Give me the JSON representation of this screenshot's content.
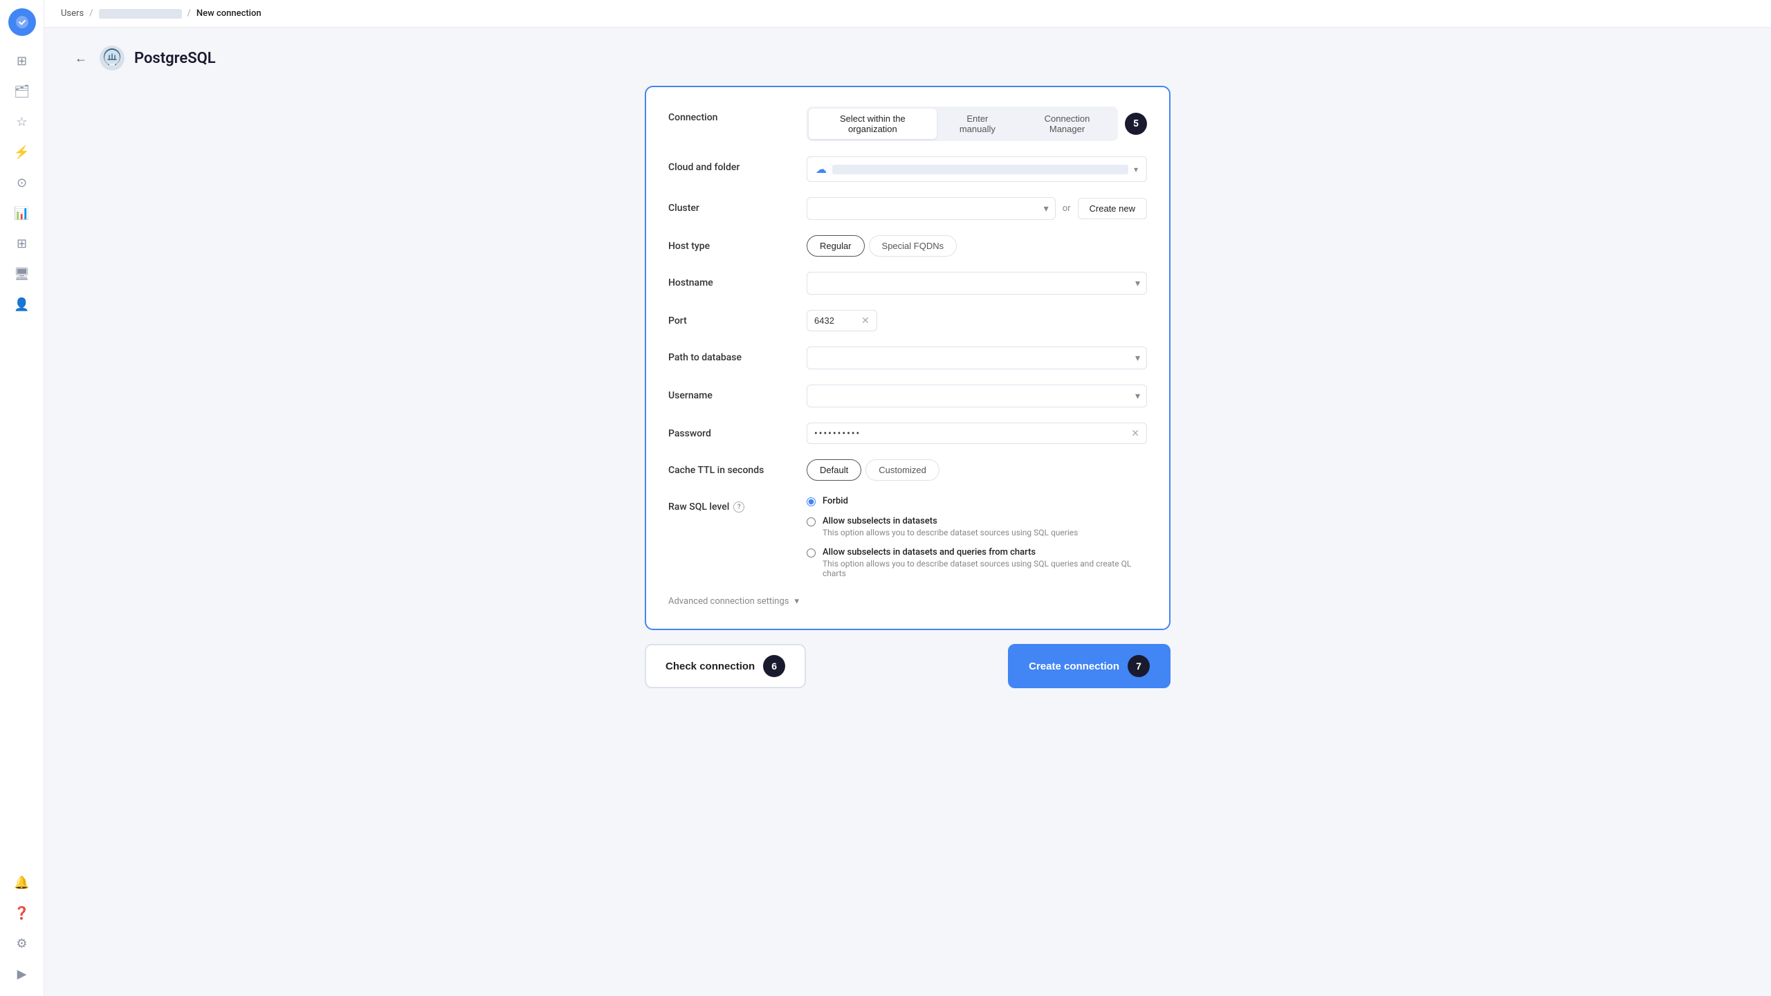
{
  "breadcrumb": {
    "users_label": "Users",
    "separator": "/",
    "new_connection_label": "New connection"
  },
  "page": {
    "title": "PostgreSQL",
    "back_label": "←"
  },
  "connection_section": {
    "label": "Connection",
    "tab_select_org": "Select within the organization",
    "tab_enter_manually": "Enter manually",
    "tab_connection_manager": "Connection Manager",
    "step_badge": "5"
  },
  "cloud_folder": {
    "label": "Cloud and folder"
  },
  "cluster": {
    "label": "Cluster",
    "or_text": "or",
    "create_new_label": "Create new",
    "placeholder": ""
  },
  "host_type": {
    "label": "Host type",
    "options": [
      "Regular",
      "Special FQDNs"
    ]
  },
  "hostname": {
    "label": "Hostname",
    "placeholder": ""
  },
  "port": {
    "label": "Port",
    "value": "6432"
  },
  "path_to_database": {
    "label": "Path to database",
    "placeholder": ""
  },
  "username": {
    "label": "Username",
    "placeholder": ""
  },
  "password": {
    "label": "Password",
    "value": "••••••••••"
  },
  "cache_ttl": {
    "label": "Cache TTL in seconds",
    "options": [
      "Default",
      "Customized"
    ]
  },
  "raw_sql": {
    "label": "Raw SQL level",
    "help_icon": "?",
    "options": [
      {
        "id": "forbid",
        "label": "Forbid",
        "desc": "",
        "checked": true
      },
      {
        "id": "allow_subselects",
        "label": "Allow subselects in datasets",
        "desc": "This option allows you to describe dataset sources using SQL queries",
        "checked": false
      },
      {
        "id": "allow_subselects_charts",
        "label": "Allow subselects in datasets and queries from charts",
        "desc": "This option allows you to describe dataset sources using SQL queries and create QL charts",
        "checked": false
      }
    ]
  },
  "advanced_settings": {
    "label": "Advanced connection settings"
  },
  "check_connection": {
    "label": "Check connection",
    "badge": "6"
  },
  "create_connection": {
    "label": "Create connection",
    "badge": "7"
  }
}
